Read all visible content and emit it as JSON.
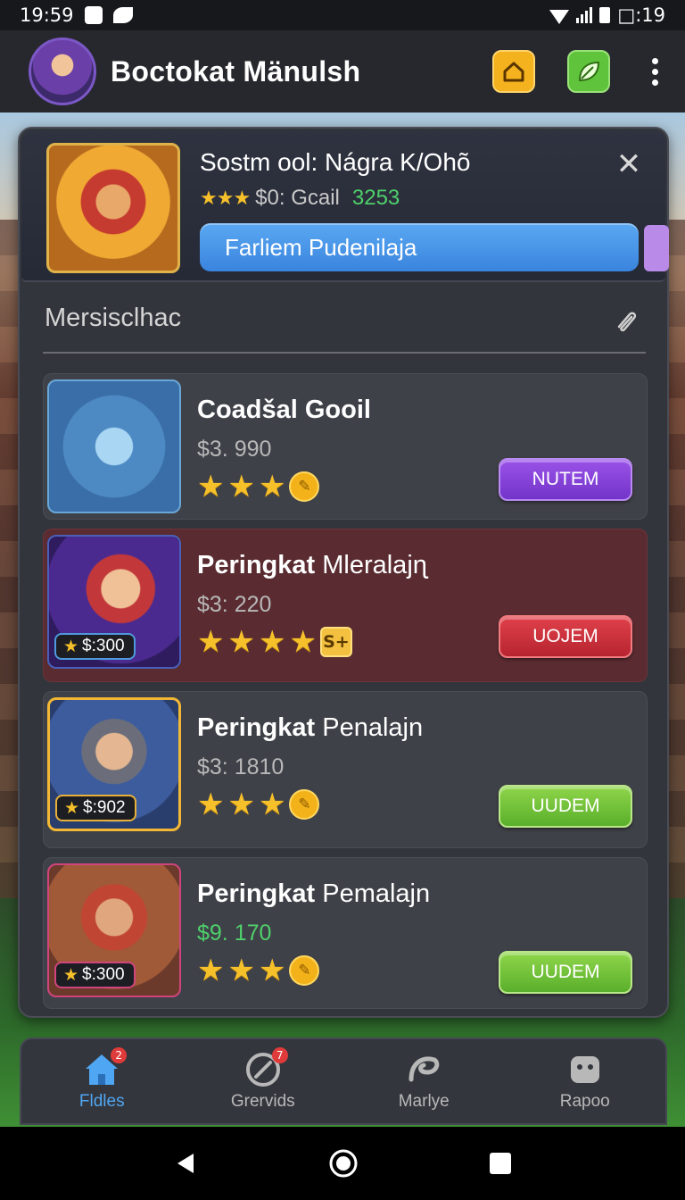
{
  "status_bar": {
    "time": "19:59",
    "right_text": "□:19"
  },
  "header": {
    "title": "Boctokat Mänulsh",
    "icons": [
      "avatar",
      "home-icon",
      "leaf-icon",
      "more-icon"
    ]
  },
  "featured": {
    "title": "Sostm ool: Nágra K/Ohõ",
    "rating_text": "$0: Gcail",
    "value": "3253",
    "progress_label": "Farliem Pudenilaja",
    "close_icon": "close-icon"
  },
  "section": {
    "title": "Mersisclhac",
    "icon": "link-icon"
  },
  "items": [
    {
      "title_bold": "Coadšal Gooil",
      "title_rest": "",
      "price": "$3. 990",
      "stars": 3,
      "extra": "coin",
      "extra_text": "",
      "badge": "",
      "button": "NUTEM",
      "button_color": "#7334c9"
    },
    {
      "title_bold": "Peringkat",
      "title_rest": " Mleralajɳ",
      "price": "$3: 220",
      "stars": 4,
      "extra": "tag",
      "extra_text": "S+",
      "badge": "$:300",
      "button": "UOJEM",
      "button_color": "#b72430"
    },
    {
      "title_bold": "Peringkat",
      "title_rest": " Penalajn",
      "price": "$3: 1810",
      "stars": 3,
      "extra": "coin",
      "extra_text": "",
      "badge": "$:902",
      "button": "UUDEM",
      "button_color": "#5aaf2c"
    },
    {
      "title_bold": "Peringkat",
      "title_rest": " Pemalajn",
      "price": "$9. 170",
      "stars": 3,
      "extra": "coin",
      "extra_text": "",
      "badge": "$:300",
      "button": "UUDEM",
      "button_color": "#5aaf2c"
    }
  ],
  "bottom_nav": [
    {
      "label": "Fldles",
      "icon": "home-icon",
      "active": true,
      "badge": "2"
    },
    {
      "label": "Grervids",
      "icon": "compass-icon",
      "active": false,
      "badge": "7"
    },
    {
      "label": "Marlye",
      "icon": "swirl-icon",
      "active": false,
      "badge": ""
    },
    {
      "label": "Rapoo",
      "icon": "robot-icon",
      "active": false,
      "badge": ""
    }
  ],
  "colors": {
    "accent_blue": "#4fa6f2",
    "accent_green": "#4fd06b",
    "star": "#f5c02a"
  }
}
